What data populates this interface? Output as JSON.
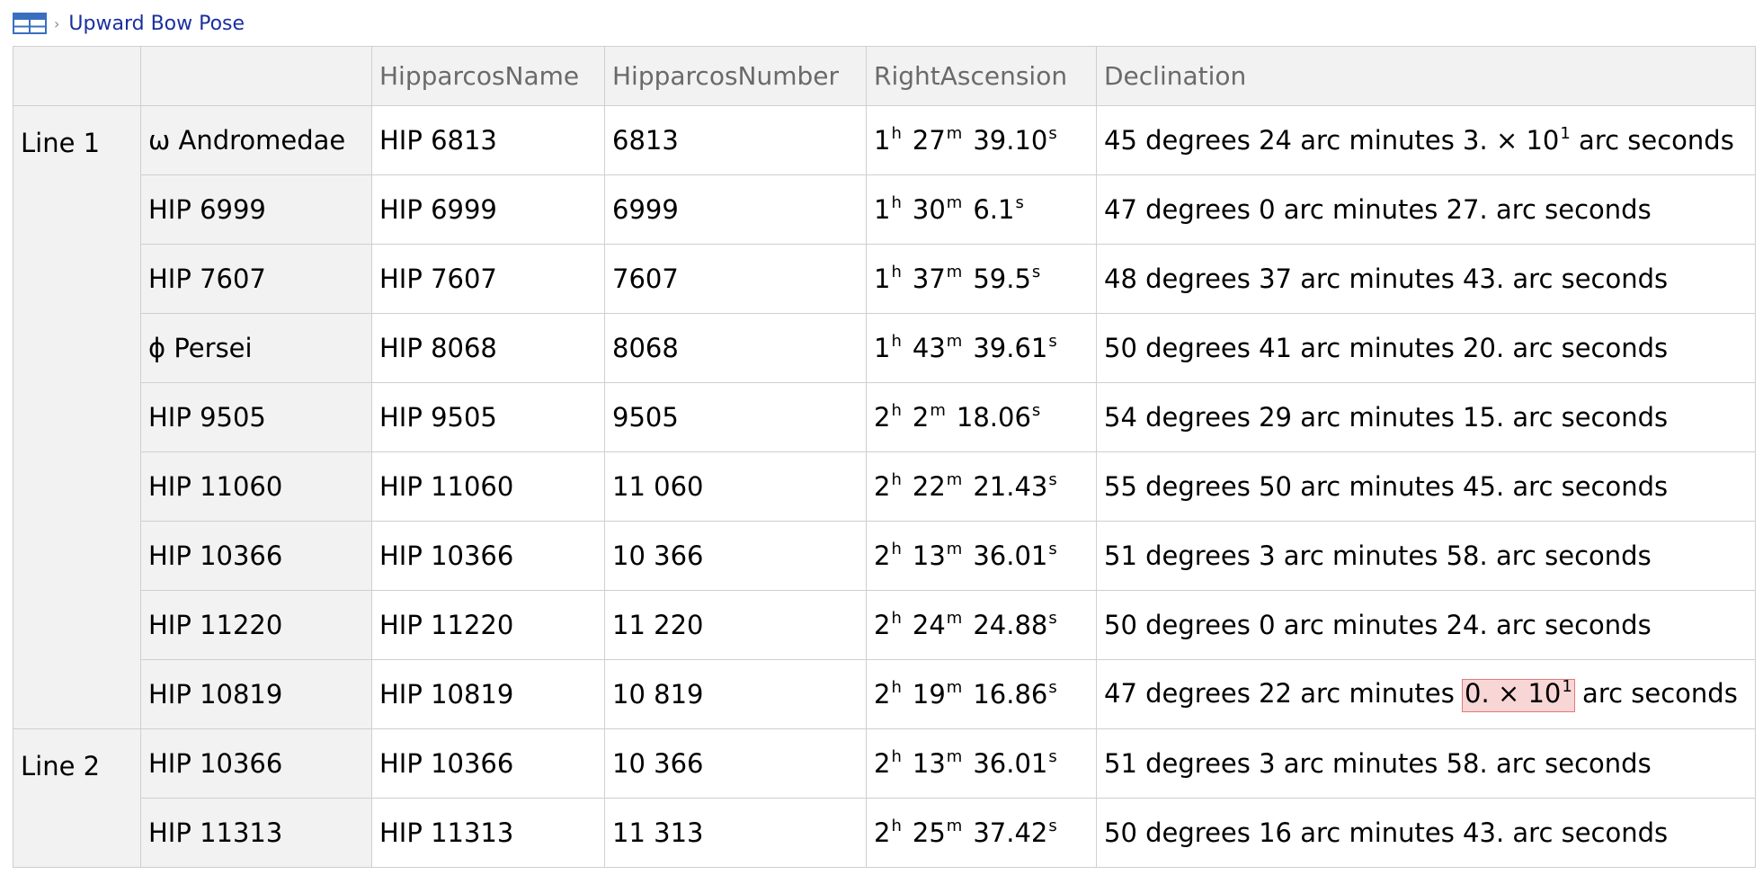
{
  "breadcrumb": {
    "icon": "table-icon",
    "separator": "›",
    "title": "Upward Bow Pose"
  },
  "columns": [
    "",
    "",
    "HipparcosName",
    "HipparcosNumber",
    "RightAscension",
    "Declination"
  ],
  "groups": [
    {
      "label": "Line 1",
      "rows": [
        {
          "star": "ω Andromedae",
          "hip_name": "HIP 6813",
          "hip_number": "6813",
          "ra": {
            "h": "1",
            "m": "27",
            "s": "39.10"
          },
          "dec": {
            "deg": "45",
            "arcmin": "24",
            "arcsec_mantissa": "3.",
            "times": "×",
            "base": "10",
            "exp": "1",
            "deg_unit": "degrees",
            "arcmin_unit": "arc minutes",
            "arcsec_unit": "arc seconds"
          }
        },
        {
          "star": "HIP 6999",
          "hip_name": "HIP 6999",
          "hip_number": "6999",
          "ra": {
            "h": "1",
            "m": "30",
            "s": "6.1"
          },
          "dec": {
            "deg": "47",
            "arcmin": "0",
            "arcsec": "27.",
            "deg_unit": "degrees",
            "arcmin_unit": "arc minutes",
            "arcsec_unit": "arc seconds"
          }
        },
        {
          "star": "HIP 7607",
          "hip_name": "HIP 7607",
          "hip_number": "7607",
          "ra": {
            "h": "1",
            "m": "37",
            "s": "59.5"
          },
          "dec": {
            "deg": "48",
            "arcmin": "37",
            "arcsec": "43.",
            "deg_unit": "degrees",
            "arcmin_unit": "arc minutes",
            "arcsec_unit": "arc seconds"
          }
        },
        {
          "star": "ϕ Persei",
          "hip_name": "HIP 8068",
          "hip_number": "8068",
          "ra": {
            "h": "1",
            "m": "43",
            "s": "39.61"
          },
          "dec": {
            "deg": "50",
            "arcmin": "41",
            "arcsec": "20.",
            "deg_unit": "degrees",
            "arcmin_unit": "arc minutes",
            "arcsec_unit": "arc seconds"
          }
        },
        {
          "star": "HIP 9505",
          "hip_name": "HIP 9505",
          "hip_number": "9505",
          "ra": {
            "h": "2",
            "m": "2",
            "s": "18.06"
          },
          "dec": {
            "deg": "54",
            "arcmin": "29",
            "arcsec": "15.",
            "deg_unit": "degrees",
            "arcmin_unit": "arc minutes",
            "arcsec_unit": "arc seconds"
          }
        },
        {
          "star": "HIP 11060",
          "hip_name": "HIP 11060",
          "hip_number": "11 060",
          "ra": {
            "h": "2",
            "m": "22",
            "s": "21.43"
          },
          "dec": {
            "deg": "55",
            "arcmin": "50",
            "arcsec": "45.",
            "deg_unit": "degrees",
            "arcmin_unit": "arc minutes",
            "arcsec_unit": "arc seconds"
          }
        },
        {
          "star": "HIP 10366",
          "hip_name": "HIP 10366",
          "hip_number": "10 366",
          "ra": {
            "h": "2",
            "m": "13",
            "s": "36.01"
          },
          "dec": {
            "deg": "51",
            "arcmin": "3",
            "arcsec": "58.",
            "deg_unit": "degrees",
            "arcmin_unit": "arc minutes",
            "arcsec_unit": "arc seconds"
          }
        },
        {
          "star": "HIP 11220",
          "hip_name": "HIP 11220",
          "hip_number": "11 220",
          "ra": {
            "h": "2",
            "m": "24",
            "s": "24.88"
          },
          "dec": {
            "deg": "50",
            "arcmin": "0",
            "arcsec": "24.",
            "deg_unit": "degrees",
            "arcmin_unit": "arc minutes",
            "arcsec_unit": "arc seconds"
          }
        },
        {
          "star": "HIP 10819",
          "hip_name": "HIP 10819",
          "hip_number": "10 819",
          "ra": {
            "h": "2",
            "m": "19",
            "s": "16.86"
          },
          "dec": {
            "deg": "47",
            "arcmin": "22",
            "arcsec_mantissa": "0.",
            "times": "×",
            "base": "10",
            "exp": "1",
            "highlight": true,
            "deg_unit": "degrees",
            "arcmin_unit": "arc minutes",
            "arcsec_unit": "arc seconds"
          }
        }
      ]
    },
    {
      "label": "Line 2",
      "rows": [
        {
          "star": "HIP 10366",
          "hip_name": "HIP 10366",
          "hip_number": "10 366",
          "ra": {
            "h": "2",
            "m": "13",
            "s": "36.01"
          },
          "dec": {
            "deg": "51",
            "arcmin": "3",
            "arcsec": "58.",
            "deg_unit": "degrees",
            "arcmin_unit": "arc minutes",
            "arcsec_unit": "arc seconds"
          }
        },
        {
          "star": "HIP 11313",
          "hip_name": "HIP 11313",
          "hip_number": "11 313",
          "ra": {
            "h": "2",
            "m": "25",
            "s": "37.42"
          },
          "dec": {
            "deg": "50",
            "arcmin": "16",
            "arcsec": "43.",
            "deg_unit": "degrees",
            "arcmin_unit": "arc minutes",
            "arcsec_unit": "arc seconds"
          }
        }
      ]
    }
  ]
}
